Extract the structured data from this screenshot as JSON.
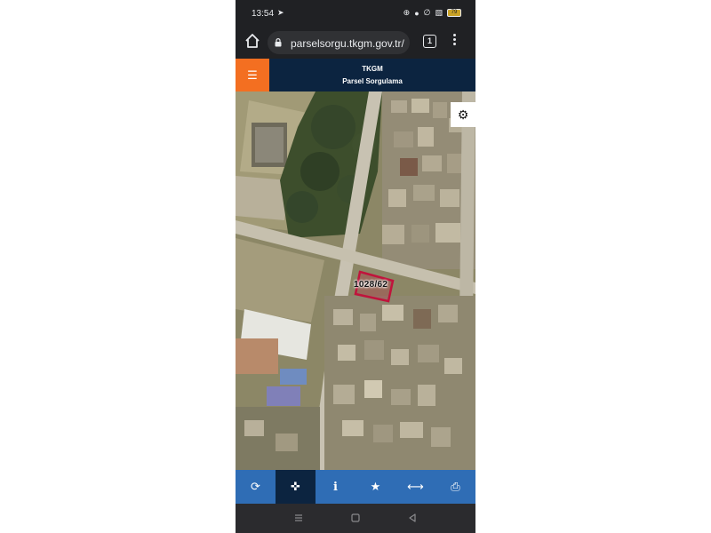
{
  "status_bar": {
    "time": "13:54",
    "battery": "79"
  },
  "browser": {
    "url": "parselsorgu.tkgm.gov.tr/",
    "tab_count": "1"
  },
  "app_header": {
    "title": "TKGM",
    "subtitle": "Parsel Sorgulama",
    "menu_icon": "hamburger-icon"
  },
  "map": {
    "parcel_label": "1028/62",
    "settings_icon": "gear-icon",
    "colors": {
      "parcel_outline": "#c0143c",
      "header_bg": "#0c2440",
      "menu_bg": "#f36f21",
      "toolbar_bg": "#2f6db5"
    }
  },
  "toolbar": {
    "buttons": [
      {
        "icon": "refresh-icon",
        "active": false
      },
      {
        "icon": "locate-icon",
        "active": true
      },
      {
        "icon": "info-icon",
        "active": false
      },
      {
        "icon": "star-icon",
        "active": false
      },
      {
        "icon": "measure-icon",
        "active": false
      },
      {
        "icon": "print-icon",
        "active": false
      }
    ]
  },
  "navigation": [
    "recent-apps-icon",
    "home-icon",
    "back-icon"
  ]
}
